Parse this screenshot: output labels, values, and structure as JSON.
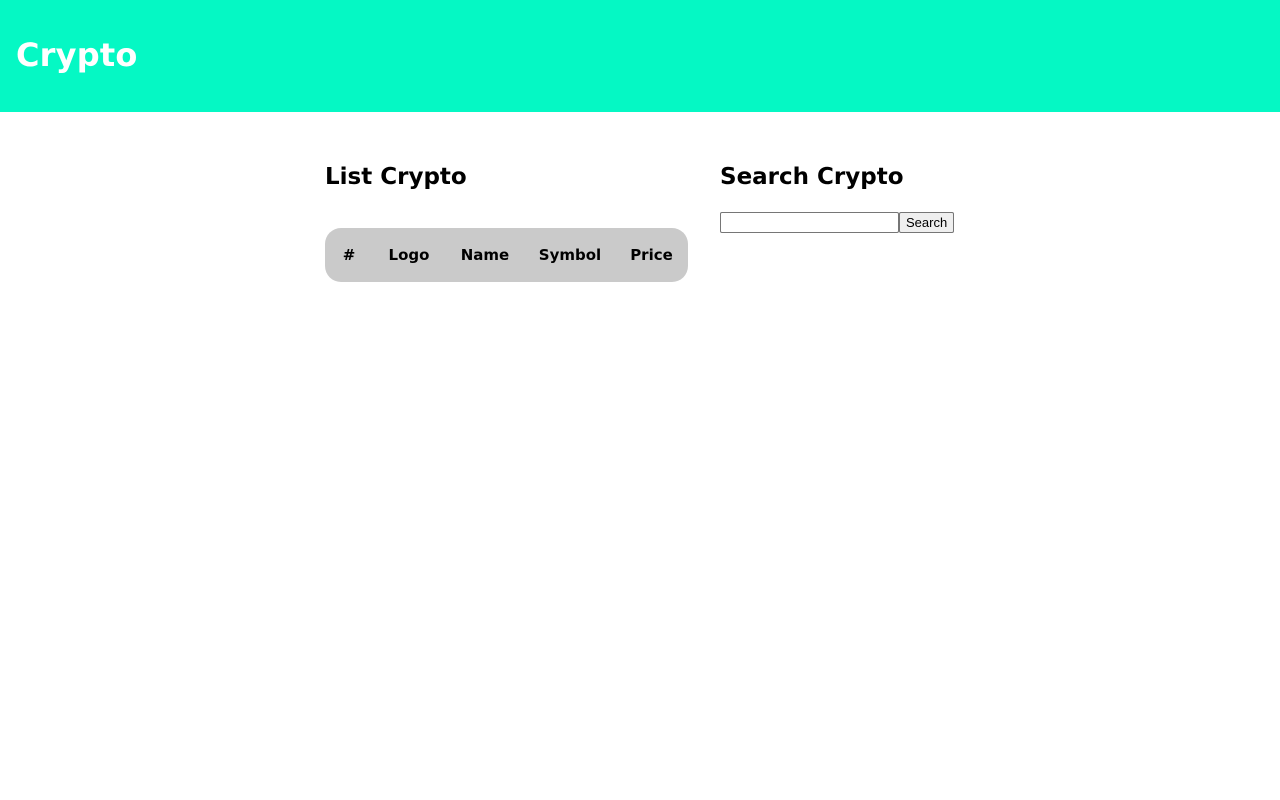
{
  "header": {
    "title": "Crypto",
    "background_color": "#05f8c4"
  },
  "list_section": {
    "title": "List Crypto",
    "table": {
      "columns": [
        "#",
        "Logo",
        "Name",
        "Symbol",
        "Price"
      ],
      "rows": [],
      "header_color": "#cacaca"
    }
  },
  "search_section": {
    "title": "Search Crypto",
    "input_value": "",
    "input_placeholder": "",
    "button_label": "Search"
  }
}
